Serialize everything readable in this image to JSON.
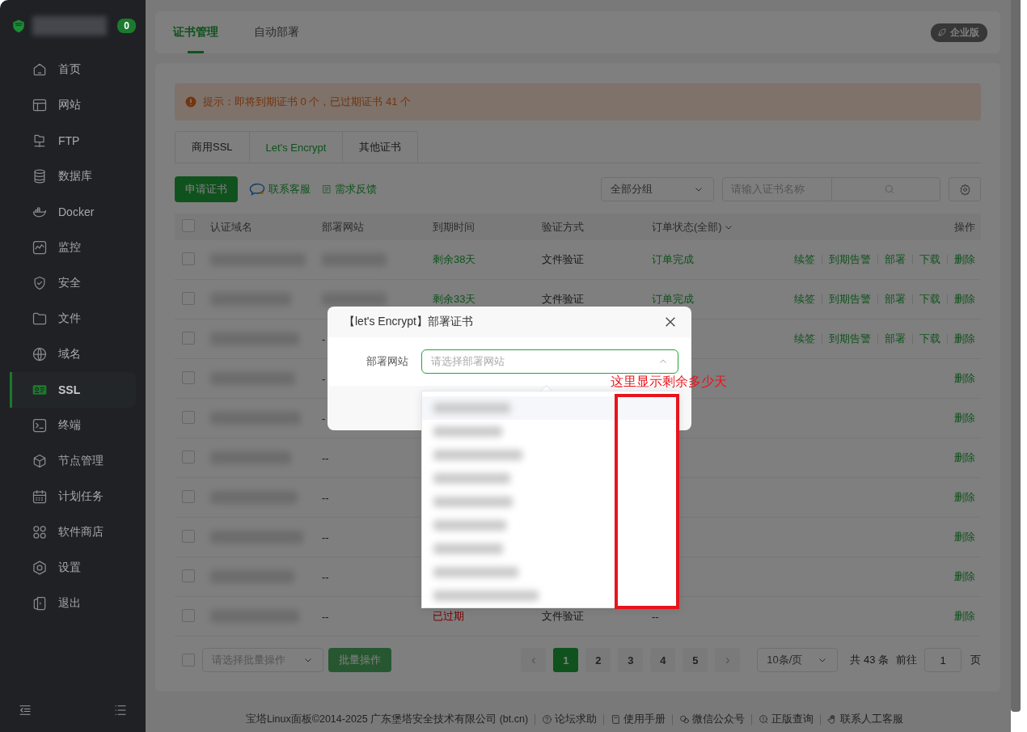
{
  "sidebar": {
    "badge": "0",
    "items": [
      {
        "label": "首页",
        "selected": false
      },
      {
        "label": "网站",
        "selected": false
      },
      {
        "label": "FTP",
        "selected": false
      },
      {
        "label": "数据库",
        "selected": false
      },
      {
        "label": "Docker",
        "selected": false
      },
      {
        "label": "监控",
        "selected": false
      },
      {
        "label": "安全",
        "selected": false
      },
      {
        "label": "文件",
        "selected": false
      },
      {
        "label": "域名",
        "selected": false
      },
      {
        "label": "SSL",
        "selected": true
      },
      {
        "label": "终端",
        "selected": false
      },
      {
        "label": "节点管理",
        "selected": false
      },
      {
        "label": "计划任务",
        "selected": false
      },
      {
        "label": "软件商店",
        "selected": false
      },
      {
        "label": "设置",
        "selected": false
      },
      {
        "label": "退出",
        "selected": false
      }
    ]
  },
  "tabs": [
    {
      "label": "证书管理",
      "selected": true
    },
    {
      "label": "自动部署",
      "selected": false
    }
  ],
  "edition_badge": "企业版",
  "alert": "提示：即将到期证书 0 个，已过期证书 41 个",
  "cert_tabs": [
    {
      "label": "商用SSL",
      "selected": false
    },
    {
      "label": "Let's Encrypt",
      "selected": true
    },
    {
      "label": "其他证书",
      "selected": false
    }
  ],
  "toolbar": {
    "apply_button": "申请证书",
    "links": [
      "联系客服",
      "需求反馈"
    ],
    "group_select": "全部分组",
    "search": {
      "placeholder": "请输入证书名称"
    }
  },
  "table": {
    "select_all": {
      "checked": false
    },
    "columns": [
      "认证域名",
      "部署网站",
      "到期时间",
      "验证方式",
      "订单状态(全部)",
      "操作"
    ],
    "rows": [
      {
        "checked": false,
        "domain": {
          "kind": "redacted"
        },
        "site": {
          "kind": "redacted"
        },
        "expiry": {
          "text": "剩余38天",
          "kind": "remaining"
        },
        "method": "文件验证",
        "status": "订单完成",
        "actions": [
          "续签",
          "到期告警",
          "部署",
          "下载",
          "删除"
        ]
      },
      {
        "checked": false,
        "domain": {
          "kind": "redacted"
        },
        "site": {
          "kind": "redacted"
        },
        "expiry": {
          "text": "剩余33天",
          "kind": "remaining"
        },
        "method": "文件验证",
        "status": "订单完成",
        "actions": [
          "续签",
          "到期告警",
          "部署",
          "下载",
          "删除"
        ]
      },
      {
        "checked": false,
        "domain": {
          "kind": "redacted"
        },
        "site": {
          "kind": "text",
          "text": "-"
        },
        "actions": [
          "续签",
          "到期告警",
          "部署",
          "下载",
          "删除"
        ]
      },
      {
        "checked": false,
        "domain": {
          "kind": "redacted"
        },
        "site": {
          "kind": "text",
          "text": "-"
        },
        "actions": [
          "删除"
        ]
      },
      {
        "checked": false,
        "domain": {
          "kind": "redacted"
        },
        "site": {
          "kind": "text",
          "text": "-"
        },
        "actions": [
          "删除"
        ]
      },
      {
        "checked": false,
        "domain": {
          "kind": "redacted"
        },
        "site": {
          "kind": "text",
          "text": "--"
        },
        "actions": [
          "删除"
        ]
      },
      {
        "checked": false,
        "domain": {
          "kind": "redacted"
        },
        "site": {
          "kind": "text",
          "text": "--"
        },
        "actions": [
          "删除"
        ]
      },
      {
        "checked": false,
        "domain": {
          "kind": "redacted"
        },
        "site": {
          "kind": "text",
          "text": "--"
        },
        "actions": [
          "删除"
        ]
      },
      {
        "checked": false,
        "domain": {
          "kind": "redacted"
        },
        "site": {
          "kind": "text",
          "text": "--"
        },
        "actions": [
          "删除"
        ]
      },
      {
        "checked": false,
        "domain": {
          "kind": "redacted"
        },
        "site": {
          "kind": "text",
          "text": "--"
        },
        "expiry": {
          "text": "已过期",
          "kind": "expired"
        },
        "method": "文件验证",
        "status": "--",
        "actions": [
          "删除"
        ]
      }
    ]
  },
  "pagination": {
    "select_all": {
      "checked": false
    },
    "batch_select": {
      "placeholder": "请选择批量操作"
    },
    "batch_button": "批量操作",
    "prev": "‹",
    "next": "›",
    "pages": [
      {
        "label": "1",
        "selected": true
      },
      {
        "label": "2",
        "selected": false
      },
      {
        "label": "3",
        "selected": false
      },
      {
        "label": "4",
        "selected": false
      },
      {
        "label": "5",
        "selected": false
      }
    ],
    "page_size": "10条/页",
    "total": "共 43 条",
    "goto_label": "前往",
    "goto_value": "1",
    "page_unit": "页"
  },
  "footer": {
    "copyright": "宝塔Linux面板©2014-2025 广东堡塔安全技术有限公司 (bt.cn)",
    "links": [
      "论坛求助",
      "使用手册",
      "微信公众号",
      "正版查询",
      "联系人工客服"
    ]
  },
  "modal": {
    "title": "【let's Encrypt】部署证书",
    "field_label": "部署网站",
    "select": {
      "placeholder": "请选择部署网站",
      "expanded": true
    },
    "options": [
      {
        "kind": "redacted",
        "selected": true
      },
      {
        "kind": "redacted",
        "selected": false
      },
      {
        "kind": "redacted",
        "selected": false
      },
      {
        "kind": "redacted",
        "selected": false
      },
      {
        "kind": "redacted",
        "selected": false
      },
      {
        "kind": "redacted",
        "selected": false
      },
      {
        "kind": "redacted",
        "selected": false
      },
      {
        "kind": "redacted",
        "selected": false
      },
      {
        "kind": "redacted",
        "selected": false
      }
    ]
  },
  "annotation": {
    "text": "这里显示剩余多少天"
  }
}
